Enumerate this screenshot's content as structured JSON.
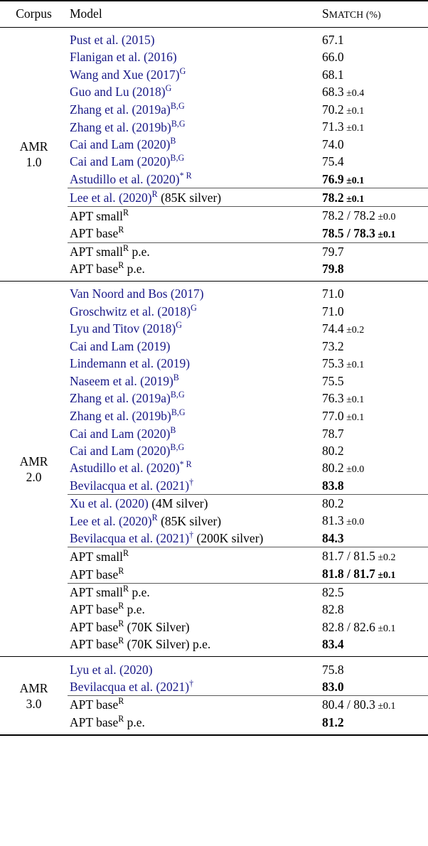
{
  "table": {
    "header": {
      "corpus": "Corpus",
      "model": "Model",
      "metric_first": "S",
      "metric_rest": "MATCH (%)"
    },
    "sections": [
      {
        "corpus_label_line1": "AMR",
        "corpus_label_line2": "1.0",
        "groups": [
          {
            "rows": [
              {
                "model": "Pust et al. (2015)",
                "sup": "",
                "suffix": "",
                "cited": true,
                "score": "67.1",
                "pm": "",
                "bold": false
              },
              {
                "model": "Flanigan et al. (2016)",
                "sup": "",
                "suffix": "",
                "cited": true,
                "score": "66.0",
                "pm": "",
                "bold": false
              },
              {
                "model": "Wang and Xue (2017)",
                "sup": "G",
                "suffix": "",
                "cited": true,
                "score": "68.1",
                "pm": "",
                "bold": false
              },
              {
                "model": "Guo and Lu (2018)",
                "sup": "G",
                "suffix": "",
                "cited": true,
                "score": "68.3",
                "pm": "±0.4",
                "bold": false
              },
              {
                "model": "Zhang et al. (2019a)",
                "sup": "B,G",
                "suffix": "",
                "cited": true,
                "score": "70.2",
                "pm": "±0.1",
                "bold": false
              },
              {
                "model": "Zhang et al. (2019b)",
                "sup": "B,G",
                "suffix": "",
                "cited": true,
                "score": "71.3",
                "pm": "±0.1",
                "bold": false
              },
              {
                "model": "Cai and Lam (2020)",
                "sup": "B",
                "suffix": "",
                "cited": true,
                "score": "74.0",
                "pm": "",
                "bold": false
              },
              {
                "model": "Cai and Lam (2020)",
                "sup": "B,G",
                "suffix": "",
                "cited": true,
                "score": "75.4",
                "pm": "",
                "bold": false
              },
              {
                "model": "Astudillo et al. (2020)",
                "sup": "* R",
                "suffix": "",
                "cited": true,
                "score": "76.9",
                "pm": "±0.1",
                "bold": true
              }
            ]
          },
          {
            "rows": [
              {
                "model": "Lee et al. (2020)",
                "sup": "R",
                "suffix": " (85K silver)",
                "cited": true,
                "score": "78.2",
                "pm": "±0.1",
                "bold": true
              }
            ]
          },
          {
            "rows": [
              {
                "model": "APT small",
                "sup": "R",
                "suffix": "",
                "cited": false,
                "score": "78.2 / 78.2",
                "pm": "±0.0",
                "bold": false
              },
              {
                "model": "APT base",
                "sup": "R",
                "suffix": "",
                "cited": false,
                "score": "78.5 / 78.3",
                "pm": "±0.1",
                "bold": true
              }
            ]
          },
          {
            "rows": [
              {
                "model": "APT small",
                "sup": "R",
                "suffix": " p.e.",
                "cited": false,
                "score": "79.7",
                "pm": "",
                "bold": false
              },
              {
                "model": "APT base",
                "sup": "R",
                "suffix": " p.e.",
                "cited": false,
                "score": "79.8",
                "pm": "",
                "bold": true
              }
            ]
          }
        ]
      },
      {
        "corpus_label_line1": "AMR",
        "corpus_label_line2": "2.0",
        "groups": [
          {
            "rows": [
              {
                "model": "Van Noord and Bos (2017)",
                "sup": "",
                "suffix": "",
                "cited": true,
                "score": "71.0",
                "pm": "",
                "bold": false
              },
              {
                "model": "Groschwitz et al. (2018)",
                "sup": "G",
                "suffix": "",
                "cited": true,
                "score": "71.0",
                "pm": "",
                "bold": false
              },
              {
                "model": "Lyu and Titov (2018)",
                "sup": "G",
                "suffix": "",
                "cited": true,
                "score": "74.4",
                "pm": "±0.2",
                "bold": false
              },
              {
                "model": "Cai and Lam (2019)",
                "sup": "",
                "suffix": "",
                "cited": true,
                "score": "73.2",
                "pm": "",
                "bold": false
              },
              {
                "model": "Lindemann et al. (2019)",
                "sup": "",
                "suffix": "",
                "cited": true,
                "score": "75.3",
                "pm": "±0.1",
                "bold": false
              },
              {
                "model": "Naseem et al. (2019)",
                "sup": "B",
                "suffix": "",
                "cited": true,
                "score": "75.5",
                "pm": "",
                "bold": false
              },
              {
                "model": "Zhang et al. (2019a)",
                "sup": "B,G",
                "suffix": "",
                "cited": true,
                "score": "76.3",
                "pm": "±0.1",
                "bold": false
              },
              {
                "model": "Zhang et al. (2019b)",
                "sup": "B,G",
                "suffix": "",
                "cited": true,
                "score": "77.0",
                "pm": "±0.1",
                "bold": false
              },
              {
                "model": "Cai and Lam (2020)",
                "sup": "B",
                "suffix": "",
                "cited": true,
                "score": "78.7",
                "pm": "",
                "bold": false
              },
              {
                "model": "Cai and Lam (2020)",
                "sup": "B,G",
                "suffix": "",
                "cited": true,
                "score": "80.2",
                "pm": "",
                "bold": false
              },
              {
                "model": "Astudillo et al. (2020)",
                "sup": "* R",
                "suffix": "",
                "cited": true,
                "score": "80.2",
                "pm": "±0.0",
                "bold": false
              },
              {
                "model": "Bevilacqua et al. (2021)",
                "sup": "†",
                "suffix": "",
                "cited": true,
                "score": "83.8",
                "pm": "",
                "bold": true
              }
            ]
          },
          {
            "rows": [
              {
                "model": "Xu et al. (2020)",
                "sup": "",
                "suffix": " (4M silver)",
                "cited": true,
                "score": "80.2",
                "pm": "",
                "bold": false
              },
              {
                "model": "Lee et al. (2020)",
                "sup": "R",
                "suffix": " (85K silver)",
                "cited": true,
                "score": "81.3",
                "pm": "±0.0",
                "bold": false
              },
              {
                "model": "Bevilacqua et al. (2021)",
                "sup": "†",
                "suffix": " (200K silver)",
                "cited": true,
                "score": "84.3",
                "pm": "",
                "bold": true
              }
            ]
          },
          {
            "rows": [
              {
                "model": "APT small",
                "sup": "R",
                "suffix": "",
                "cited": false,
                "score": "81.7 / 81.5",
                "pm": "±0.2",
                "bold": false
              },
              {
                "model": "APT base",
                "sup": "R",
                "suffix": "",
                "cited": false,
                "score": "81.8 / 81.7",
                "pm": "±0.1",
                "bold": true
              }
            ]
          },
          {
            "rows": [
              {
                "model": "APT small",
                "sup": "R",
                "suffix": " p.e.",
                "cited": false,
                "score": "82.5",
                "pm": "",
                "bold": false
              },
              {
                "model": "APT base",
                "sup": "R",
                "suffix": " p.e.",
                "cited": false,
                "score": "82.8",
                "pm": "",
                "bold": false
              },
              {
                "model": "APT base",
                "sup": "R",
                "suffix": " (70K Silver)",
                "cited": false,
                "score": "82.8 / 82.6",
                "pm": "±0.1",
                "bold": false
              },
              {
                "model": "APT base",
                "sup": "R",
                "suffix": " (70K Silver) p.e.",
                "cited": false,
                "score": "83.4",
                "pm": "",
                "bold": true
              }
            ]
          }
        ]
      },
      {
        "corpus_label_line1": "AMR",
        "corpus_label_line2": "3.0",
        "groups": [
          {
            "rows": [
              {
                "model": "Lyu et al. (2020)",
                "sup": "",
                "suffix": "",
                "cited": true,
                "score": "75.8",
                "pm": "",
                "bold": false
              },
              {
                "model": "Bevilacqua et al. (2021)",
                "sup": "†",
                "suffix": "",
                "cited": true,
                "score": "83.0",
                "pm": "",
                "bold": true
              }
            ]
          },
          {
            "rows": [
              {
                "model": "APT base",
                "sup": "R",
                "suffix": "",
                "cited": false,
                "score": "80.4 / 80.3",
                "pm": "±0.1",
                "bold": false
              },
              {
                "model": "APT base",
                "sup": "R",
                "suffix": " p.e.",
                "cited": false,
                "score": "81.2",
                "pm": "",
                "bold": true
              }
            ]
          }
        ]
      }
    ]
  },
  "colors": {
    "citation": "#181887",
    "rule": "#000000",
    "subrule": "#5a5a5a",
    "text": "#000000"
  }
}
